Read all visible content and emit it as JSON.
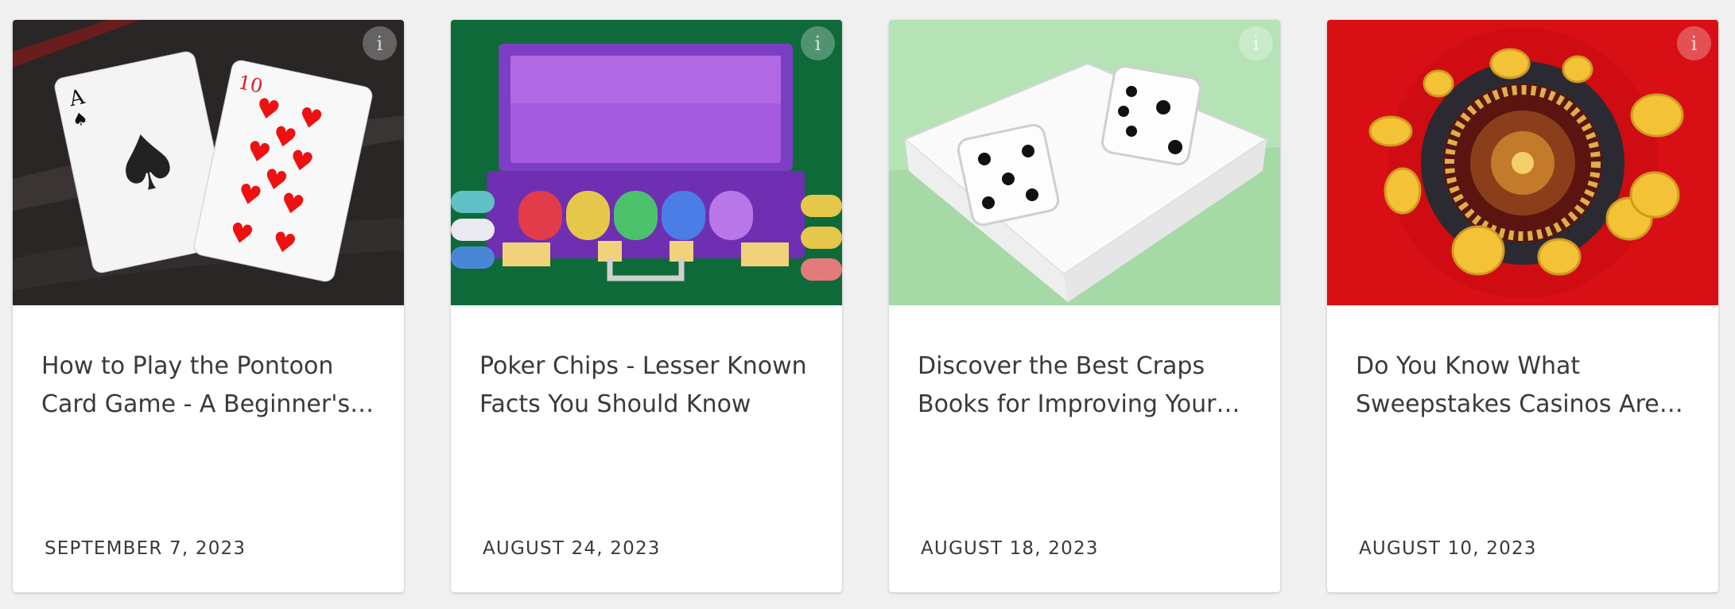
{
  "articles": [
    {
      "title": "How to Play the Pontoon Card Game - A Beginner's Guide",
      "date": "SEPTEMBER 7, 2023",
      "info_glyph": "i",
      "image": "playing-cards-ace-and-ten"
    },
    {
      "title": "Poker Chips - Lesser Known Facts You Should Know",
      "date": "AUGUST 24, 2023",
      "info_glyph": "i",
      "image": "poker-chip-case"
    },
    {
      "title": "Discover the Best Craps Books for Improving Your Game",
      "date": "AUGUST 18, 2023",
      "info_glyph": "i",
      "image": "dice-on-book"
    },
    {
      "title": "Do You Know What Sweepstakes Casinos Are and How They Work",
      "date": "AUGUST 10, 2023",
      "info_glyph": "i",
      "image": "roulette-wheel-with-coins"
    }
  ]
}
